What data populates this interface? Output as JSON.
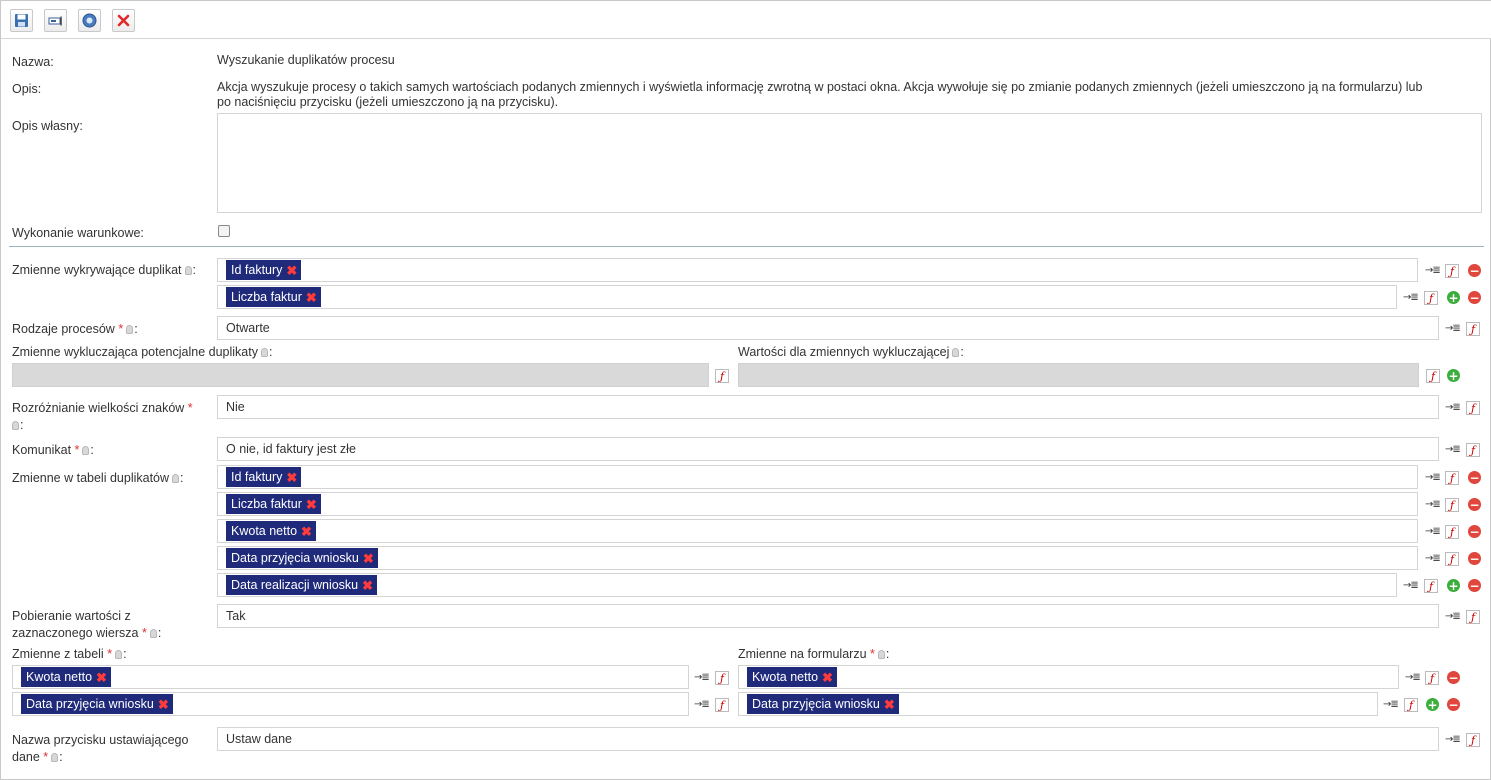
{
  "toolbar": {
    "icons": [
      "save-icon",
      "rename-icon",
      "help-icon",
      "close-icon"
    ]
  },
  "info": {
    "name_label": "Nazwa:",
    "name_value": "Wyszukanie duplikatów procesu",
    "desc_label": "Opis:",
    "desc_line1": "Akcja wyszukuje procesy o takich samych wartościach podanych zmiennych i wyświetla informację zwrotną w postaci okna. Akcja wywołuje się po zmianie podanych zmiennych (jeżeli umieszczono ją na formularzu) lub",
    "desc_line2": "po naciśnięciu przycisku (jeżeli umieszczono ją na przycisku).",
    "own_desc_label": "Opis własny:",
    "own_desc_value": "",
    "conditional_label": "Wykonanie warunkowe:"
  },
  "fields": {
    "dup_vars_label": "Zmienne wykrywające duplikat",
    "dup_vars": [
      "Id faktury",
      "Liczba faktur"
    ],
    "process_types_label": "Rodzaje procesów",
    "process_types_value": "Otwarte",
    "excl_vars_label": "Zmienne wykluczająca potencjalne duplikaty",
    "excl_values_label": "Wartości dla zmiennych wykluczającej",
    "case_label_1": "Rozróżnianie wielkości znaków",
    "case_value": "Nie",
    "message_label": "Komunikat",
    "message_value": "O nie, id faktury jest złe",
    "table_vars_label": "Zmienne w tabeli duplikatów",
    "table_vars": [
      "Id faktury",
      "Liczba faktur",
      "Kwota netto",
      "Data przyjęcia wniosku",
      "Data realizacji wniosku"
    ],
    "fetch_label_1": "Pobieranie wartości z",
    "fetch_label_2": "zaznaczonego wiersza",
    "fetch_value": "Tak",
    "from_table_label": "Zmienne z tabeli",
    "from_table": [
      "Kwota netto",
      "Data przyjęcia wniosku"
    ],
    "on_form_label": "Zmienne na formularzu",
    "on_form": [
      "Kwota netto",
      "Data przyjęcia wniosku"
    ],
    "button_label_1": "Nazwa przycisku ustawiającego",
    "button_label_2": "dane",
    "button_value": "Ustaw dane",
    "required_mark": "*",
    "colon": ":",
    "remove_mark": "✖"
  },
  "colors": {
    "tag_bg": "#1f2a7a",
    "tag_remove": "#ff3b3b",
    "required": "#e03030",
    "minus": "#e0463c",
    "plus": "#3cae3c"
  }
}
